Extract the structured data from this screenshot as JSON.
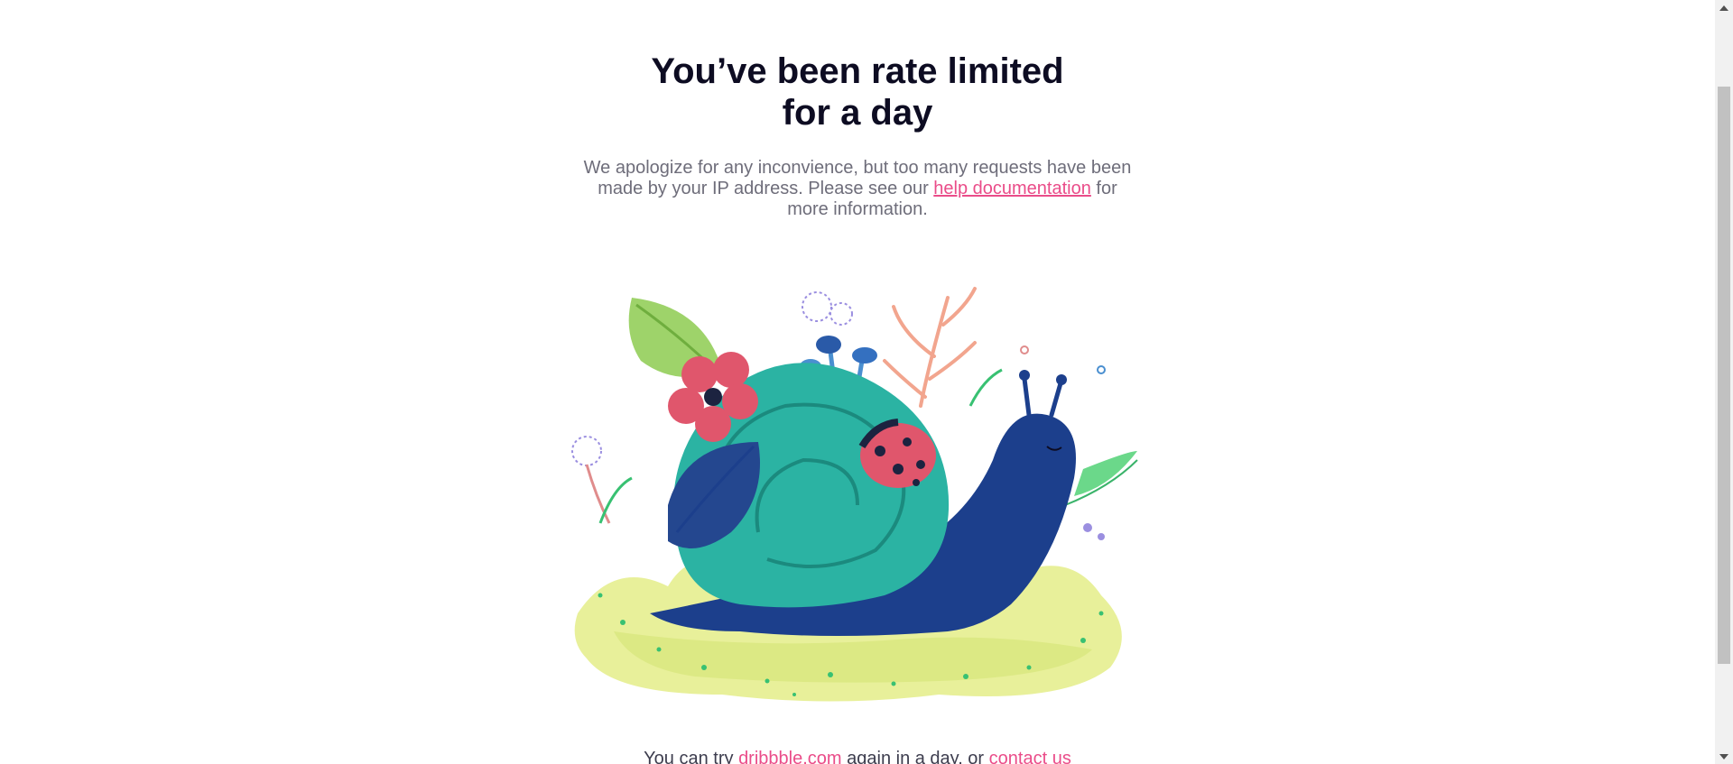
{
  "heading": {
    "line1": "You’ve been rate limited",
    "line2": "for a day"
  },
  "description": {
    "before_link": "We apologize for any inconvience, but too many requests have been made by your IP address. Please see our ",
    "link_text": "help documentation",
    "after_link": " for more information."
  },
  "illustration": {
    "subject": "snail-with-ladybug-illustration"
  },
  "footer": {
    "before": "You can try ",
    "site_link": "dribbble.com",
    "middle": " again in a day, or ",
    "contact_link": "contact us"
  },
  "colors": {
    "heading": "#0d0c22",
    "body_text": "#6e6d7a",
    "link": "#ea4c89",
    "snail_shell": "#2bb3a3",
    "snail_body": "#1c3f8c",
    "ground": "#e8f09a"
  }
}
